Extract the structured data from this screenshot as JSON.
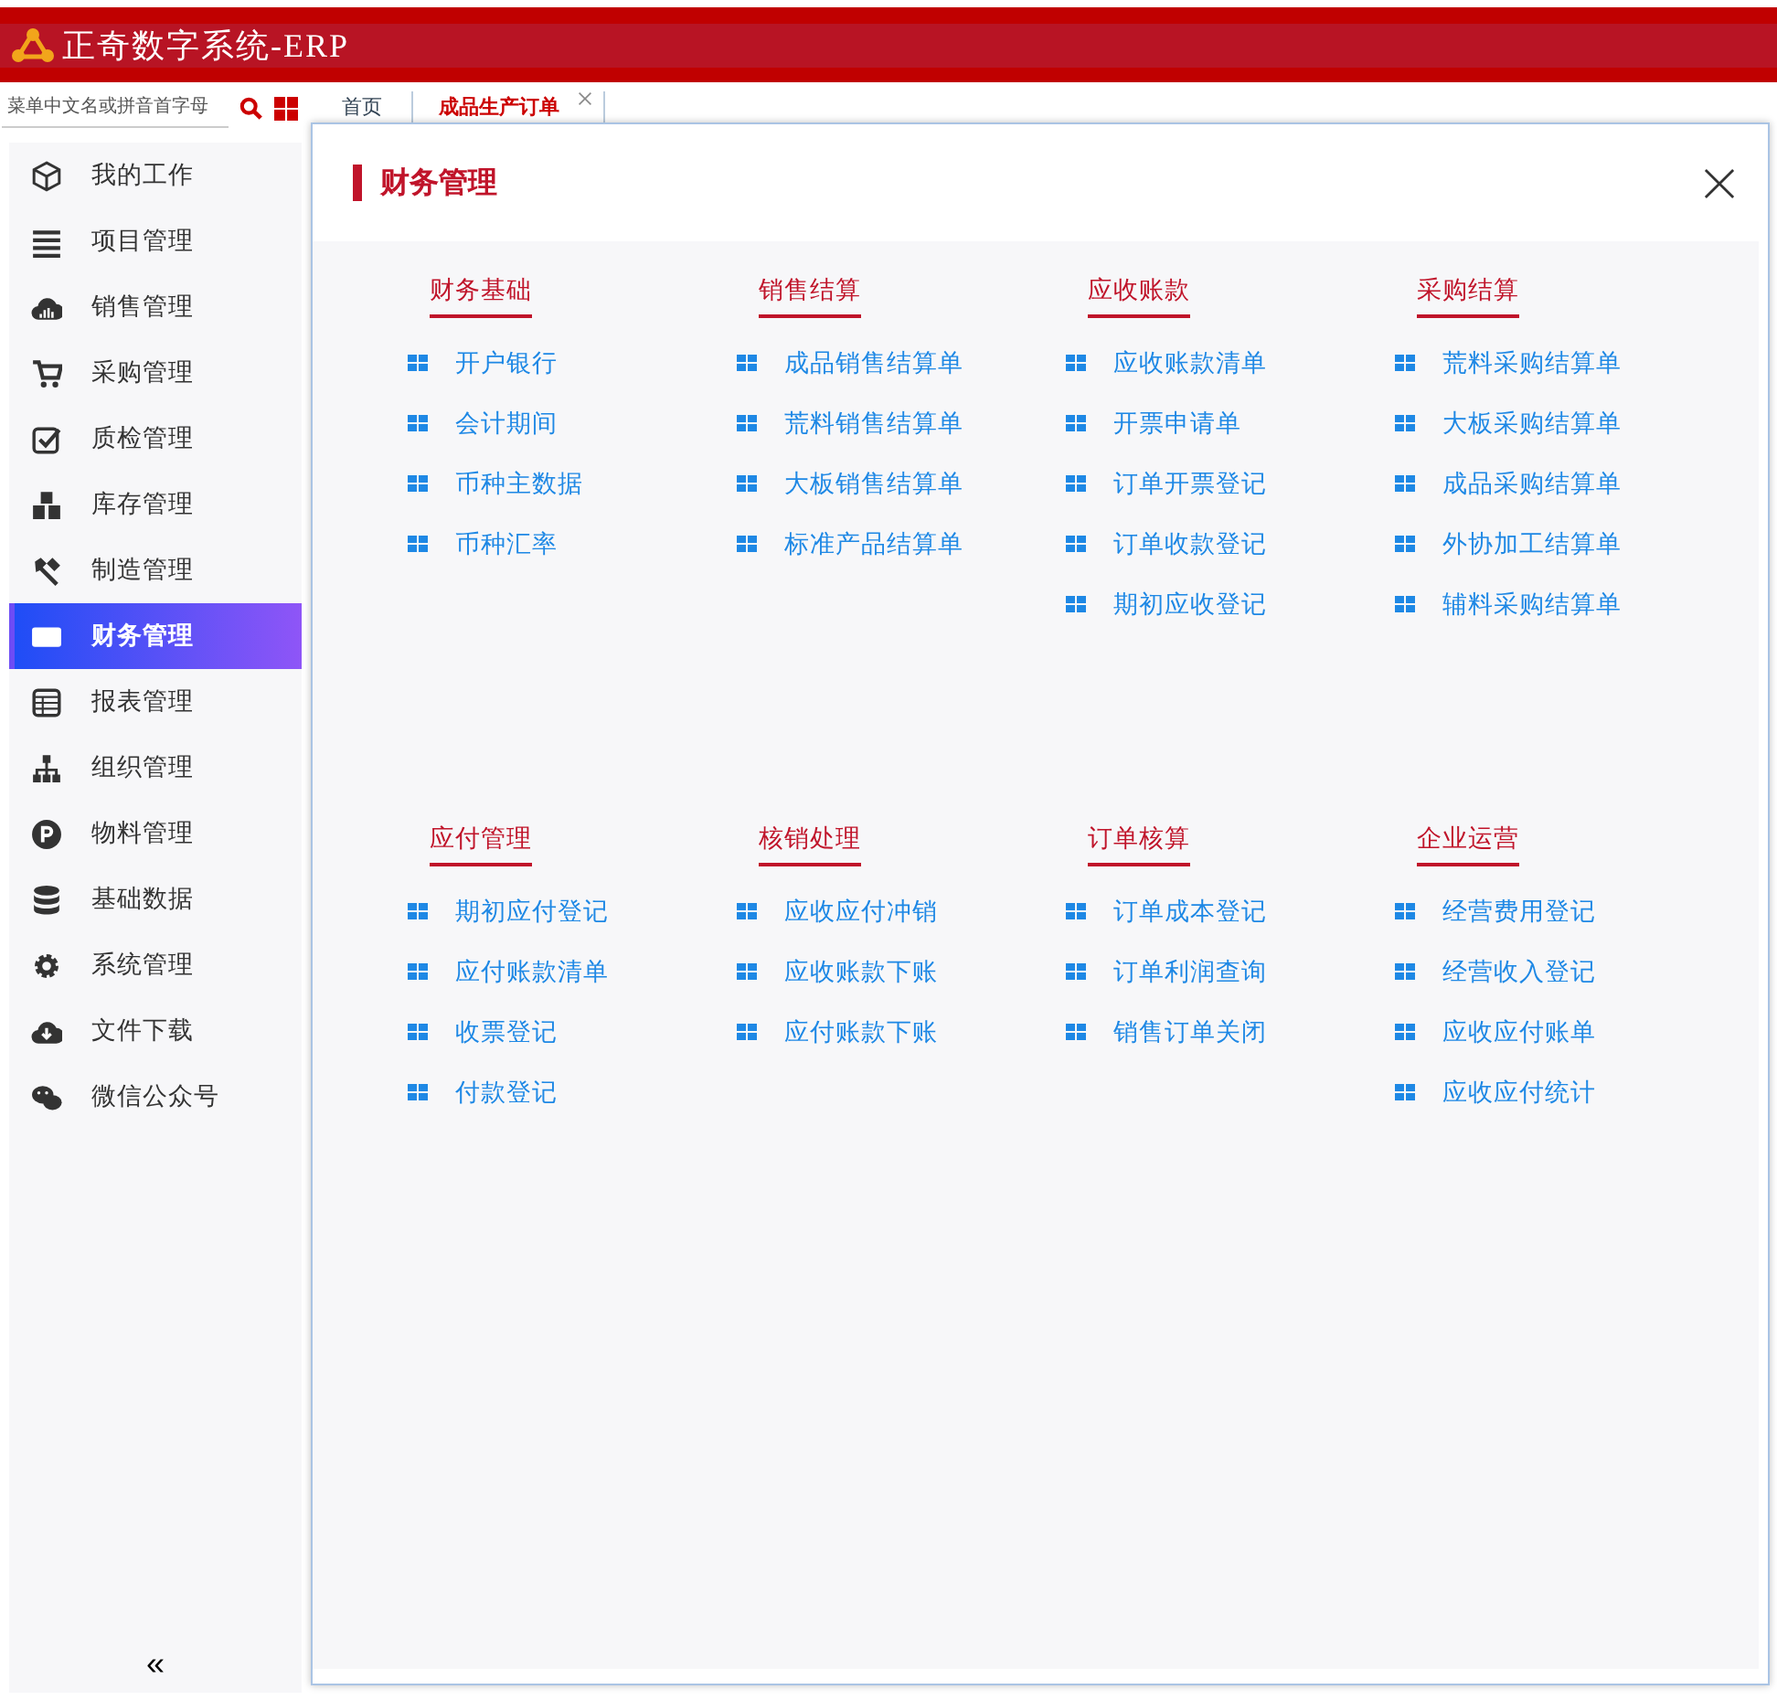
{
  "app": {
    "title": "正奇数字系统-ERP"
  },
  "toolbar": {
    "search": {
      "placeholder": "菜单中文名或拼音首字母"
    }
  },
  "tabs": [
    {
      "label": "首页",
      "selected": false,
      "closable": false
    },
    {
      "label": "成品生产订单",
      "selected": true,
      "closable": true
    }
  ],
  "sidebar": {
    "items": [
      {
        "label": "我的工作",
        "selected": false
      },
      {
        "label": "项目管理",
        "selected": false
      },
      {
        "label": "销售管理",
        "selected": false
      },
      {
        "label": "采购管理",
        "selected": false
      },
      {
        "label": "质检管理",
        "selected": false
      },
      {
        "label": "库存管理",
        "selected": false
      },
      {
        "label": "制造管理",
        "selected": false
      },
      {
        "label": "财务管理",
        "selected": true
      },
      {
        "label": "报表管理",
        "selected": false
      },
      {
        "label": "组织管理",
        "selected": false
      },
      {
        "label": "物料管理",
        "selected": false
      },
      {
        "label": "基础数据",
        "selected": false
      },
      {
        "label": "系统管理",
        "selected": false
      },
      {
        "label": "文件下载",
        "selected": false
      },
      {
        "label": "微信公众号",
        "selected": false
      }
    ],
    "collapse": "«"
  },
  "modal": {
    "title": "财务管理",
    "sections": [
      {
        "groups": [
          {
            "title": "财务基础",
            "items": [
              "开户银行",
              "会计期间",
              "币种主数据",
              "币种汇率"
            ]
          },
          {
            "title": "销售结算",
            "items": [
              "成品销售结算单",
              "荒料销售结算单",
              "大板销售结算单",
              "标准产品结算单"
            ]
          },
          {
            "title": "应收账款",
            "items": [
              "应收账款清单",
              "开票申请单",
              "订单开票登记",
              "订单收款登记",
              "期初应收登记"
            ]
          },
          {
            "title": "采购结算",
            "items": [
              "荒料采购结算单",
              "大板采购结算单",
              "成品采购结算单",
              "外协加工结算单",
              "辅料采购结算单"
            ]
          }
        ]
      },
      {
        "groups": [
          {
            "title": "应付管理",
            "items": [
              "期初应付登记",
              "应付账款清单",
              "收票登记",
              "付款登记"
            ]
          },
          {
            "title": "核销处理",
            "items": [
              "应收应付冲销",
              "应收账款下账",
              "应付账款下账"
            ]
          },
          {
            "title": "订单核算",
            "items": [
              "订单成本登记",
              "订单利润查询",
              "销售订单关闭"
            ]
          },
          {
            "title": "企业运营",
            "items": [
              "经营费用登记",
              "经营收入登记",
              "应收应付账单",
              "应收应付统计"
            ]
          }
        ]
      }
    ]
  }
}
